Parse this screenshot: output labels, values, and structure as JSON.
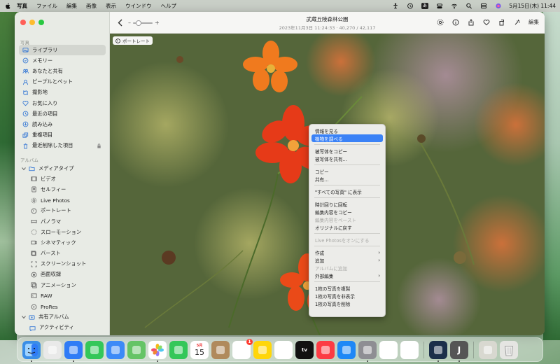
{
  "menubar": {
    "app": "写真",
    "menus": [
      "ファイル",
      "編集",
      "画像",
      "表示",
      "ウインドウ",
      "ヘルプ"
    ],
    "ime": "あ",
    "datetime": "5月15日(木)  11:44"
  },
  "sidebar": {
    "section_photos": "写真",
    "items": [
      {
        "label": "ライブラリ",
        "icon": "photo-library-icon"
      },
      {
        "label": "メモリー",
        "icon": "memories-icon"
      },
      {
        "label": "あなたと共有",
        "icon": "shared-with-you-icon"
      },
      {
        "label": "ピープルとペット",
        "icon": "people-icon"
      },
      {
        "label": "撮影地",
        "icon": "places-icon"
      },
      {
        "label": "お気に入り",
        "icon": "heart-icon"
      },
      {
        "label": "最近の項目",
        "icon": "recents-icon"
      },
      {
        "label": "読み込み",
        "icon": "imports-icon"
      },
      {
        "label": "重複項目",
        "icon": "duplicates-icon"
      },
      {
        "label": "最近削除した項目",
        "icon": "trash-icon"
      }
    ],
    "section_albums": "アルバム",
    "media_types_label": "メディアタイプ",
    "media_types": [
      {
        "label": "ビデオ",
        "icon": "video-icon"
      },
      {
        "label": "セルフィー",
        "icon": "selfie-icon"
      },
      {
        "label": "Live Photos",
        "icon": "live-photo-icon"
      },
      {
        "label": "ポートレート",
        "icon": "portrait-icon"
      },
      {
        "label": "パノラマ",
        "icon": "panorama-icon"
      },
      {
        "label": "スローモーション",
        "icon": "slomo-icon"
      },
      {
        "label": "シネマティック",
        "icon": "cinematic-icon"
      },
      {
        "label": "バースト",
        "icon": "burst-icon"
      },
      {
        "label": "スクリーンショット",
        "icon": "screenshot-icon"
      },
      {
        "label": "画面収録",
        "icon": "screen-recording-icon"
      },
      {
        "label": "アニメーション",
        "icon": "animated-icon"
      },
      {
        "label": "RAW",
        "icon": "raw-icon"
      },
      {
        "label": "ProRes",
        "icon": "prores-icon"
      }
    ],
    "shared_albums_label": "共有アルバム",
    "activity_label": "アクティビティ"
  },
  "toolbar": {
    "title": "武蔵丘陵森林公園",
    "subtitle": "2023年11月3日 11:24:33  ·  40,270 / 42,117",
    "zoom_minus": "–",
    "zoom_plus": "+",
    "edit_label": "編集",
    "zoom_level": 0.3
  },
  "photo": {
    "badge": "ポートレート"
  },
  "context_menu": {
    "items": [
      {
        "label": "情報を見る",
        "state": "normal"
      },
      {
        "label": "植物を調べる",
        "state": "highlighted"
      },
      {
        "sep": true
      },
      {
        "label": "被写体をコピー",
        "state": "normal"
      },
      {
        "label": "被写体を共有...",
        "state": "normal"
      },
      {
        "sep": true
      },
      {
        "label": "コピー",
        "state": "normal"
      },
      {
        "label": "共有...",
        "state": "normal"
      },
      {
        "sep": true
      },
      {
        "label": "\"すべての写真\" に表示",
        "state": "normal"
      },
      {
        "sep": true
      },
      {
        "label": "時計回りに回転",
        "state": "normal"
      },
      {
        "label": "編集内容をコピー",
        "state": "normal"
      },
      {
        "label": "編集内容をペースト",
        "state": "disabled"
      },
      {
        "label": "オリジナルに戻す",
        "state": "normal"
      },
      {
        "sep": true
      },
      {
        "label": "Live Photosをオンにする",
        "state": "disabled"
      },
      {
        "sep": true
      },
      {
        "label": "作成",
        "state": "normal",
        "submenu": true
      },
      {
        "label": "追加",
        "state": "normal",
        "submenu": true
      },
      {
        "label": "アルバムに追加",
        "state": "disabled"
      },
      {
        "label": "外部編集",
        "state": "normal",
        "submenu": true
      },
      {
        "sep": true
      },
      {
        "label": "1枚の写真を複製",
        "state": "normal"
      },
      {
        "label": "1枚の写真を非表示",
        "state": "normal"
      },
      {
        "label": "1枚の写真を削除",
        "state": "normal"
      }
    ]
  },
  "dock": {
    "apps": [
      {
        "name": "finder",
        "color": "#3a8ee6",
        "running": true
      },
      {
        "name": "launchpad",
        "color": "#e9e9e9"
      },
      {
        "name": "safari",
        "color": "#2f7cf6",
        "running": true
      },
      {
        "name": "messages",
        "color": "#34c759"
      },
      {
        "name": "mail",
        "color": "#3d8af7"
      },
      {
        "name": "maps",
        "color": "#65c466"
      },
      {
        "name": "photos",
        "color": "#ffffff",
        "running": true
      },
      {
        "name": "facetime",
        "color": "#34c759"
      },
      {
        "name": "calendar",
        "color": "#ffffff",
        "text": "15",
        "month": "5月"
      },
      {
        "name": "contacts",
        "color": "#b08a5c"
      },
      {
        "name": "reminders",
        "color": "#ffffff",
        "badge": "1"
      },
      {
        "name": "notes",
        "color": "#ffd60a"
      },
      {
        "name": "freeform",
        "color": "#ffffff"
      },
      {
        "name": "tv",
        "color": "#111111",
        "text": "tv"
      },
      {
        "name": "music",
        "color": "#fc3c44"
      },
      {
        "name": "app-store",
        "color": "#1e88f6"
      },
      {
        "name": "system-settings",
        "color": "#8e8e93",
        "running": true
      },
      {
        "name": "messenger",
        "color": "#ffffff"
      },
      {
        "name": "chatgpt",
        "color": "#ffffff"
      },
      {
        "sep": true
      },
      {
        "name": "app-a",
        "color": "#1c2f4a",
        "running": true
      },
      {
        "name": "app-j",
        "color": "#555555",
        "text": "J",
        "running": true
      },
      {
        "sep": true
      },
      {
        "name": "preview-docs",
        "color": "#d8d8d0"
      },
      {
        "name": "trash",
        "color": "#e5e5e2"
      }
    ]
  }
}
